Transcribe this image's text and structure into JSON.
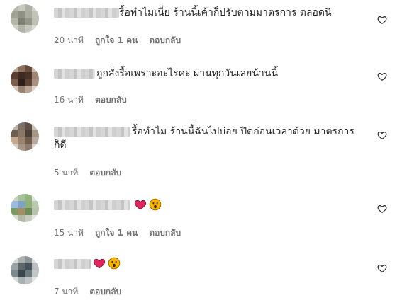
{
  "comments": [
    {
      "text_line1": "รื้อทำไมเนี่ย ร้านนี้เค้าก็ปรับตามมาตรการ ตลอดนิ",
      "text_line2": "",
      "time": "20 นาที",
      "likes": "ถูกใจ 1 คน",
      "reply": "ตอบกลับ",
      "emojis": []
    },
    {
      "text_line1": "ถูกสั่งรื้อเพราะอะไรคะ ผ่านทุกวันเลยน้านนี้",
      "text_line2": "",
      "time": "16 นาที",
      "likes": "",
      "reply": "ตอบกลับ",
      "emojis": []
    },
    {
      "text_line1": "รื้อทำไม ร้านนี้ฉันไปบ่อย ปิดก่อนเวลาด้วย มาตรการ",
      "text_line2": "ก็ดี",
      "time": "5 นาที",
      "likes": "",
      "reply": "ตอบกลับ",
      "emojis": []
    },
    {
      "text_line1": "",
      "text_line2": "",
      "time": "15 นาที",
      "likes": "ถูกใจ 1 คน",
      "reply": "ตอบกลับ",
      "emojis": [
        "heart-emoji",
        "surprised-face-emoji"
      ]
    },
    {
      "text_line1": "",
      "text_line2": "",
      "time": "7 นาที",
      "likes": "",
      "reply": "ตอบกลับ",
      "emojis": [
        "heart-emoji",
        "surprised-face-emoji"
      ]
    }
  ],
  "colors": {
    "text": "#262626",
    "meta": "#737373",
    "emoji_heart": "#e0245e",
    "emoji_face": "#f7b500"
  }
}
